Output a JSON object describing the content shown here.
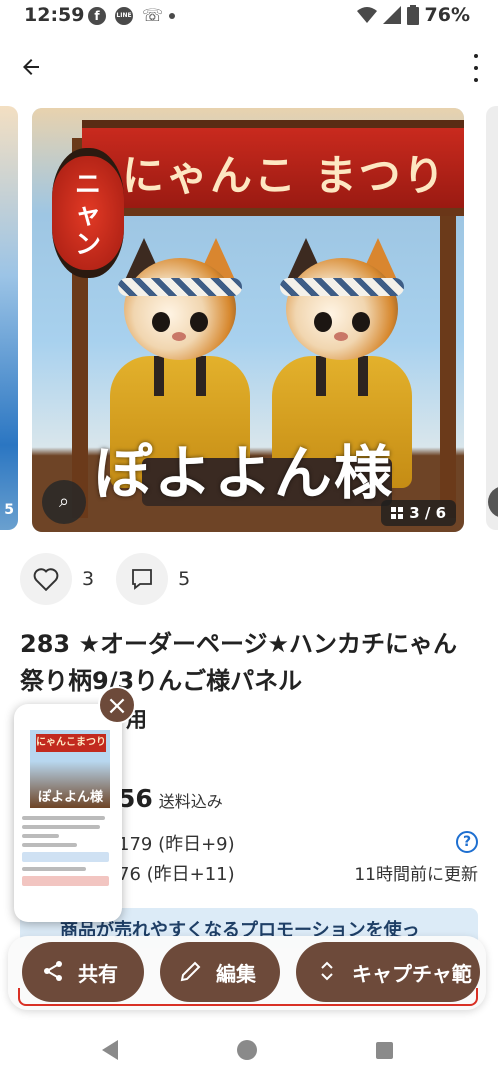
{
  "status_bar": {
    "time": "12:59",
    "left_icons": [
      "facebook-icon",
      "line-icon",
      "missed-call-icon",
      "dot"
    ],
    "battery_percent": "76%"
  },
  "app_bar": {
    "back_icon": "arrow-left-icon",
    "menu_icon": "more-vert-icon"
  },
  "carousel": {
    "left_peek_text": "5",
    "banner_text": "にゃんこ まつり",
    "lantern_text": "ニャン",
    "overlay_text": "ぽよよん様",
    "counter": "3 / 6"
  },
  "reactions": {
    "likes": "3",
    "comments": "5"
  },
  "product": {
    "title": "283 ★オーダーページ★ハンカチにゃん祭り柄9/3りんご様パネル",
    "subtitle_visible": "用",
    "price_visible": "56",
    "shipping": "送料込み",
    "stat_line_1": "179 (昨日+9)",
    "stat_line_2": "76 (昨日+11)",
    "updated": "11時間前に更新",
    "promo_text": "商品が売れやすくなるプロモーションを使っ"
  },
  "actions": {
    "share": "共有",
    "edit": "編集",
    "capture": "キャプチャ範"
  },
  "pip_preview": {
    "banner": "にゃんこまつり",
    "overlay": "ぽよよん様"
  },
  "colors": {
    "accent_brown": "#6d4a3a",
    "promo_bg": "#dcebf7",
    "help_blue": "#1e6fd0",
    "warning_red": "#d93025"
  }
}
